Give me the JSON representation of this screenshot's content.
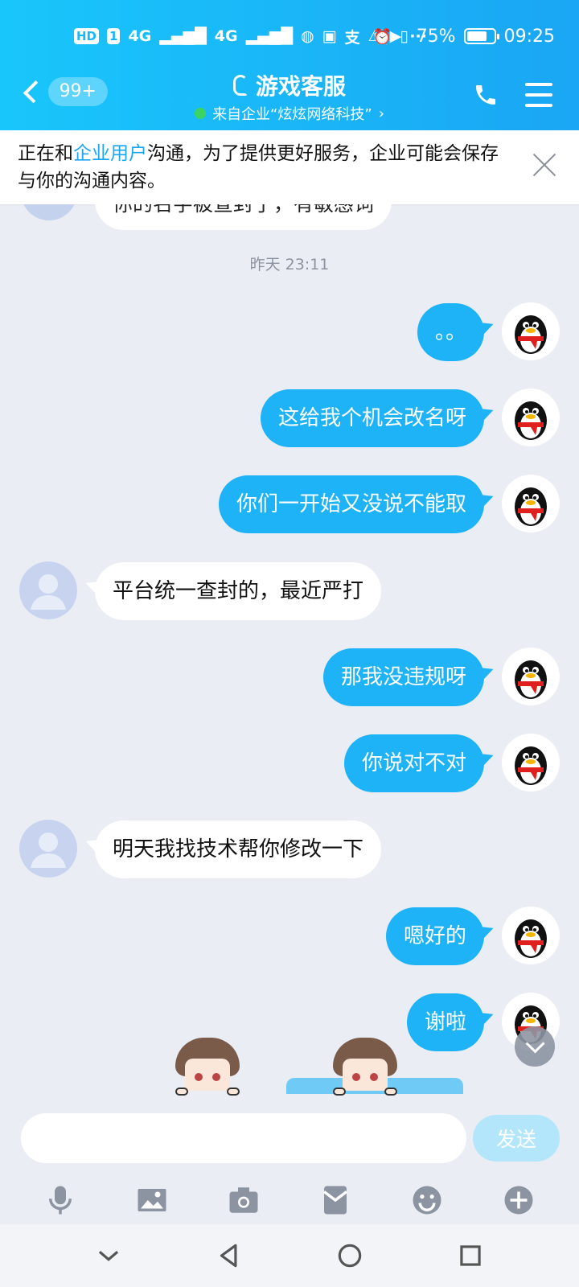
{
  "status_bar": {
    "left_items": [
      "HD",
      "1",
      "4G",
      "4G"
    ],
    "battery": "75%",
    "battery_level": 0.75,
    "time": "09:25"
  },
  "header": {
    "badge": "99+",
    "title": "游戏客服",
    "subtitle": "来自企业“炫炫网络科技”",
    "icons": [
      "back-icon",
      "ear-icon",
      "phone-icon",
      "menu-icon"
    ]
  },
  "notice": {
    "text_before": "正在和",
    "highlight": "企业用户",
    "text_after": "沟通，为了提供更好服务，企业可能会保存与你的沟通内容。"
  },
  "chat": {
    "partial_message": "你的名字被查封了，有敏感词",
    "timestamp": "昨天 23:11",
    "messages": [
      {
        "from": "me",
        "text": "。。"
      },
      {
        "from": "me",
        "text": "这给我个机会改名呀"
      },
      {
        "from": "me",
        "text": "你们一开始又没说不能取"
      },
      {
        "from": "other",
        "text": "平台统一查封的，最近严打"
      },
      {
        "from": "me",
        "text": "那我没违规呀"
      },
      {
        "from": "me",
        "text": "你说对不对"
      },
      {
        "from": "other",
        "text": "明天我找技术帮你修改一下"
      },
      {
        "from": "me",
        "text": "嗯好的"
      },
      {
        "from": "me",
        "text": "谢啦"
      }
    ]
  },
  "input": {
    "value": "",
    "send_label": "发送"
  },
  "toolbar": {
    "icons": [
      "microphone-icon",
      "image-icon",
      "camera-icon",
      "red-packet-icon",
      "emoji-icon",
      "plus-icon"
    ]
  },
  "navbar": {
    "icons": [
      "chevron-down-icon",
      "back-triangle-icon",
      "home-circle-icon",
      "recents-square-icon"
    ]
  },
  "colors": {
    "header_start": "#19c6fb",
    "header_end": "#1aa6f4",
    "my_bubble": "#1eb3f6",
    "other_bubble": "#ffffff",
    "chat_bg": "#eaedf4",
    "send_button": "#b4e6fb",
    "online_dot": "#3bd463"
  }
}
